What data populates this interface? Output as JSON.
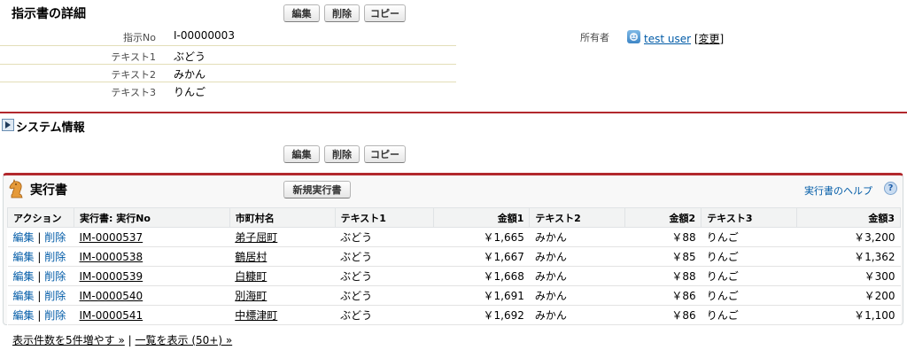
{
  "detail": {
    "title": "指示書の詳細",
    "buttons": {
      "edit": "編集",
      "delete": "削除",
      "copy": "コピー"
    },
    "fields": {
      "no_label": "指示No",
      "no_value": "I-00000003",
      "owner_label": "所有者",
      "owner_value": "test user",
      "owner_change": "[変更]",
      "text1_label": "テキスト1",
      "text1_value": "ぶどう",
      "text2_label": "テキスト2",
      "text2_value": "みかん",
      "text3_label": "テキスト3",
      "text3_value": "りんご"
    },
    "system_section": "システム情報"
  },
  "related": {
    "title": "実行書",
    "new_button": "新規実行書",
    "help": "実行書のヘルプ",
    "help_icon": "?",
    "columns": [
      "アクション",
      "実行書: 実行No",
      "市町村名",
      "テキスト1",
      "金額1",
      "テキスト2",
      "金額2",
      "テキスト3",
      "金額3"
    ],
    "rows": [
      {
        "edit": "編集",
        "del": "削除",
        "no": "IM-0000537",
        "city": "弟子屈町",
        "t1": "ぶどう",
        "a1": "￥1,665",
        "t2": "みかん",
        "a2": "￥88",
        "t3": "りんご",
        "a3": "￥3,200"
      },
      {
        "edit": "編集",
        "del": "削除",
        "no": "IM-0000538",
        "city": "鶴居村",
        "t1": "ぶどう",
        "a1": "￥1,667",
        "t2": "みかん",
        "a2": "￥85",
        "t3": "りんご",
        "a3": "￥1,362"
      },
      {
        "edit": "編集",
        "del": "削除",
        "no": "IM-0000539",
        "city": "白糠町",
        "t1": "ぶどう",
        "a1": "￥1,668",
        "t2": "みかん",
        "a2": "￥88",
        "t3": "りんご",
        "a3": "￥300"
      },
      {
        "edit": "編集",
        "del": "削除",
        "no": "IM-0000540",
        "city": "別海町",
        "t1": "ぶどう",
        "a1": "￥1,691",
        "t2": "みかん",
        "a2": "￥86",
        "t3": "りんご",
        "a3": "￥200"
      },
      {
        "edit": "編集",
        "del": "削除",
        "no": "IM-0000541",
        "city": "中標津町",
        "t1": "ぶどう",
        "a1": "￥1,692",
        "t2": "みかん",
        "a2": "￥86",
        "t3": "りんご",
        "a3": "￥1,100"
      }
    ],
    "show_more": "表示件数を5件増やす »",
    "separator": "|",
    "show_all": "一覧を表示 (50+) »"
  },
  "colors": {
    "accent": "#b2282d",
    "link": "#015ba7"
  },
  "icons": {
    "section_toggle": "expand-arrow-icon",
    "owner": "user-avatar-icon",
    "related": "chess-knight-icon",
    "help": "help-icon"
  }
}
